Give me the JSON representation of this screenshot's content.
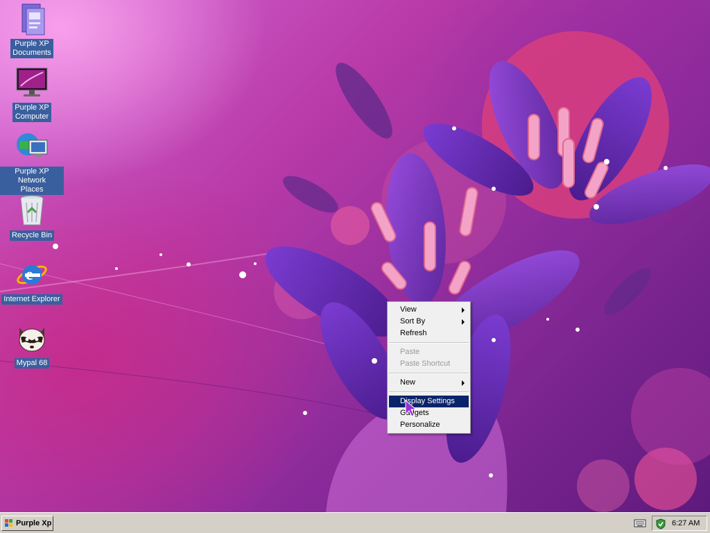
{
  "desktop": {
    "icons": [
      {
        "label_line1": "Purple XP",
        "label_line2": "Documents",
        "icon": "documents-folder-icon"
      },
      {
        "label_line1": "Purple XP",
        "label_line2": "Computer",
        "icon": "computer-monitor-icon"
      },
      {
        "label_line1": "Purple XP Network",
        "label_line2": "Places",
        "icon": "network-globe-icon"
      },
      {
        "label_line1": "Recycle Bin",
        "label_line2": "",
        "icon": "recycle-bin-icon"
      },
      {
        "label_line1": "Internet Explorer",
        "label_line2": "",
        "icon": "internet-explorer-icon"
      },
      {
        "label_line1": "Mypal 68",
        "label_line2": "",
        "icon": "mypal-raccoon-icon"
      }
    ]
  },
  "context_menu": {
    "view": "View",
    "sort_by": "Sort By",
    "refresh": "Refresh",
    "paste": "Paste",
    "paste_shortcut": "Paste Shortcut",
    "new": "New",
    "display_settings": "Display Settings",
    "gadgets": "Gadgets",
    "personalize": "Personalize",
    "highlighted_item": "Display Settings"
  },
  "taskbar": {
    "start_label": "Purple Xp",
    "clock": "6:27 AM"
  },
  "colors": {
    "selection_bg": "#0a246a",
    "label_bg": "#3a5f9e",
    "taskbar": "#d4d0c8",
    "wallpaper_main": "#9b2fa8"
  }
}
